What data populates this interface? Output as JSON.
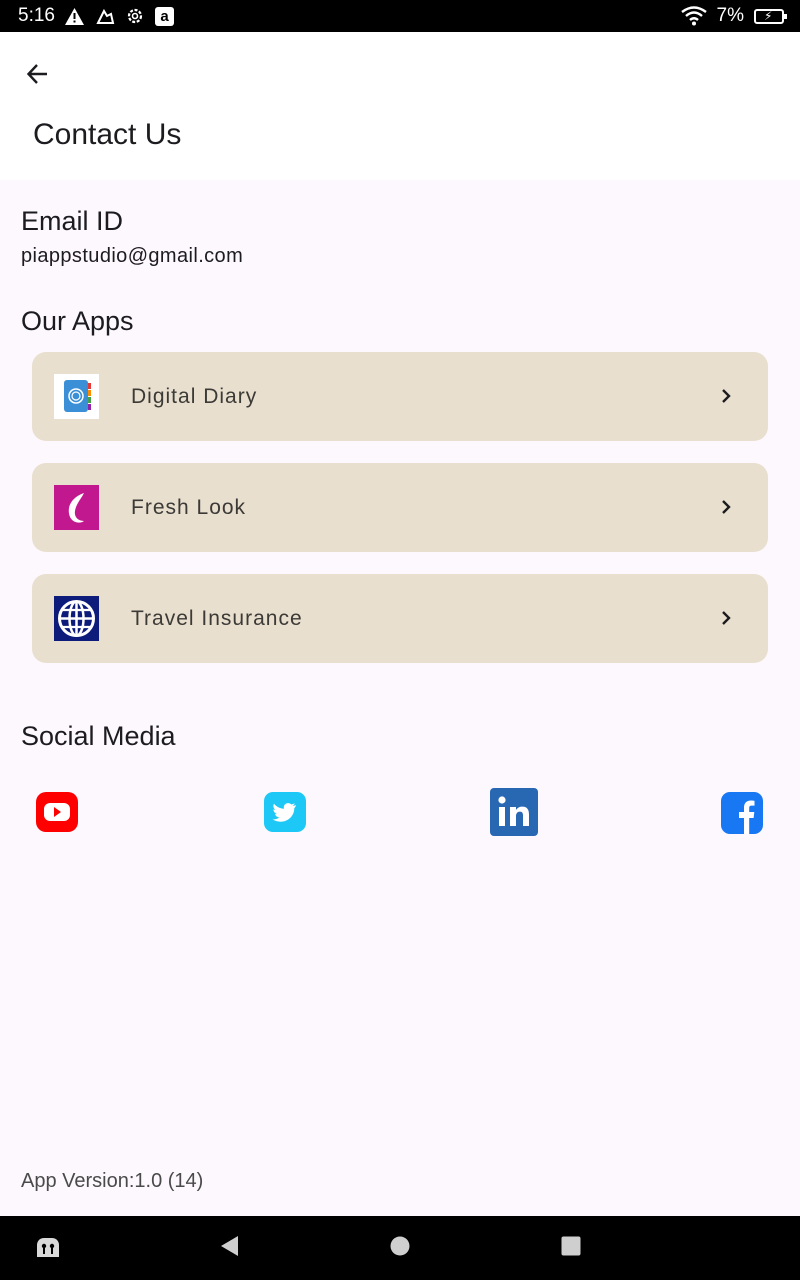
{
  "status_bar": {
    "time": "5:16",
    "battery_percent": "7%",
    "icons": [
      "warning-icon",
      "vpn-key-icon",
      "settings-icon",
      "amazon-icon",
      "wifi-icon",
      "battery-charging-icon"
    ],
    "amazon_glyph": "a"
  },
  "app_bar": {
    "title": "Contact Us",
    "back_icon": "arrow-back-icon"
  },
  "email": {
    "heading": "Email ID",
    "value": "piappstudio@gmail.com"
  },
  "our_apps": {
    "heading": "Our Apps",
    "items": [
      {
        "label": "Digital Diary",
        "icon": "digital-diary-icon"
      },
      {
        "label": "Fresh Look",
        "icon": "fresh-look-icon"
      },
      {
        "label": "Travel Insurance",
        "icon": "travel-insurance-icon"
      }
    ]
  },
  "social_media": {
    "heading": "Social Media",
    "items": [
      {
        "name": "youtube-icon",
        "color": "#ff0000"
      },
      {
        "name": "twitter-icon",
        "color": "#1da1f2"
      },
      {
        "name": "linkedin-icon",
        "color": "#0a66c2"
      },
      {
        "name": "facebook-icon",
        "color": "#1877f2"
      }
    ]
  },
  "footer": {
    "version": "App Version:1.0 (14)"
  },
  "colors": {
    "card_background": "#e9dfcf",
    "page_background": "#fdf8fd"
  }
}
